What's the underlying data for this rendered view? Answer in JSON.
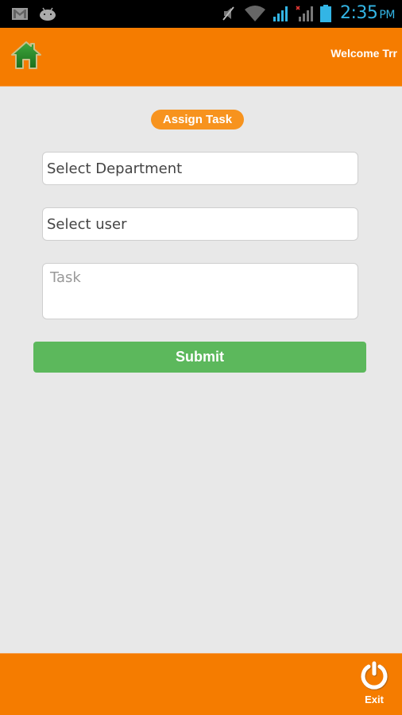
{
  "status_bar": {
    "icons": [
      "gmail-icon",
      "android-icon",
      "mute-icon",
      "wifi-icon",
      "signal-icon",
      "signal-no-data-icon",
      "battery-icon"
    ],
    "time": "2:35",
    "ampm": "PM",
    "time_color": "#33b5e5"
  },
  "header": {
    "home_icon": "home-icon",
    "welcome_text": "Welcome Trr",
    "background": "#f57c00"
  },
  "main": {
    "title": "Assign Task",
    "department_select": {
      "value": "Select Department"
    },
    "user_select": {
      "value": "Select user"
    },
    "task_field": {
      "placeholder": "Task",
      "value": ""
    },
    "submit_label": "Submit",
    "submit_color": "#5cb85c"
  },
  "footer": {
    "exit_icon": "power-icon",
    "exit_label": "Exit"
  }
}
